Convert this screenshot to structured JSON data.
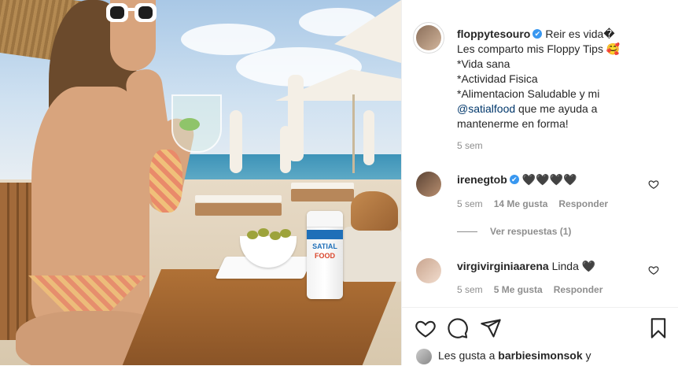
{
  "post": {
    "author": "floppytesouro",
    "verified_mark": "✔",
    "caption_lines": [
      "Reir es vida�",
      "Les comparto mis Floppy Tips 🥰",
      "*Vida sana",
      "*Actividad Fisica",
      "*Alimentacion Saludable y mi"
    ],
    "mention": "@satialfood",
    "caption_tail_1": " que me ayuda a",
    "caption_tail_2": "mantenerme en forma!",
    "time": "5 sem"
  },
  "photo": {
    "jar_brand_1": "SATIAL",
    "jar_brand_2": "FOOD"
  },
  "comments": [
    {
      "user": "irenegtob",
      "text": "🖤🖤🖤🖤",
      "time": "5 sem",
      "likes": "14 Me gusta",
      "reply": "Responder"
    },
    {
      "user": "virgivirginiaarena",
      "text": "Linda 🖤",
      "time": "5 sem",
      "likes": "5 Me gusta",
      "reply": "Responder"
    }
  ],
  "view_replies": "Ver respuestas (1)",
  "likes_bar": {
    "prefix": "Les gusta a ",
    "user": "barbiesimonsok",
    "suffix": " y"
  },
  "icons": {
    "like": "heart-icon",
    "comment": "comment-icon",
    "share": "share-icon",
    "save": "bookmark-icon",
    "comment_like": "heart-icon"
  },
  "colors": {
    "verified": "#3897f0",
    "mention": "#00376b",
    "muted": "#8e8e8e"
  }
}
